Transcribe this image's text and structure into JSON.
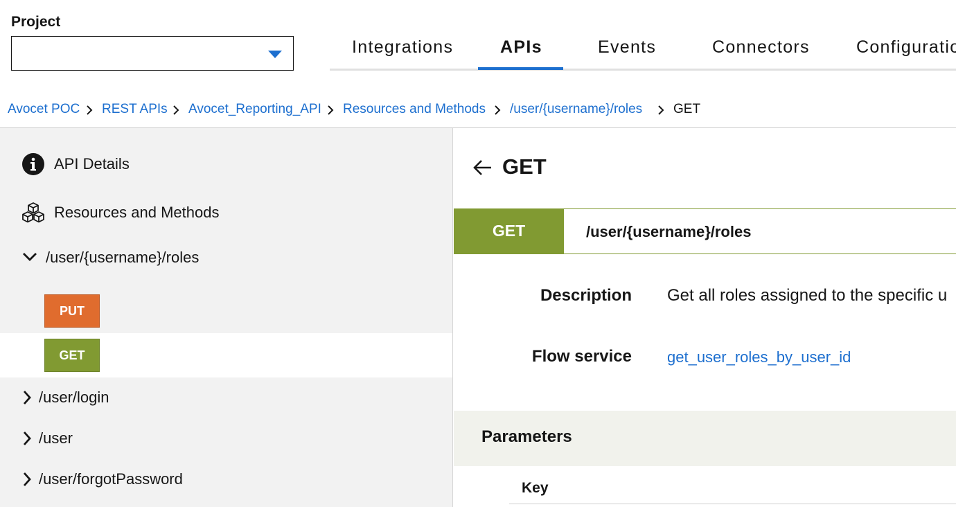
{
  "project": {
    "label": "Project",
    "value": ""
  },
  "tabs": [
    {
      "label": "Integrations",
      "active": false
    },
    {
      "label": "APIs",
      "active": true
    },
    {
      "label": "Events",
      "active": false
    },
    {
      "label": "Connectors",
      "active": false
    },
    {
      "label": "Configuratio",
      "active": false
    }
  ],
  "breadcrumb": [
    {
      "label": "Avocet POC"
    },
    {
      "label": "REST APIs"
    },
    {
      "label": "Avocet_Reporting_API"
    },
    {
      "label": "Resources and Methods"
    },
    {
      "label": "/user/{username}/roles"
    },
    {
      "label": "GET"
    }
  ],
  "sidebar": {
    "api_details": "API Details",
    "resources_methods": "Resources and Methods",
    "expanded_resource": "/user/{username}/roles",
    "methods": [
      {
        "label": "PUT",
        "color": "#e06c2e"
      },
      {
        "label": "GET",
        "color": "#819a32",
        "selected": true
      }
    ],
    "resources": [
      "/user/login",
      "/user",
      "/user/forgotPassword"
    ]
  },
  "main": {
    "title": "GET",
    "method": "GET",
    "path": "/user/{username}/roles",
    "description_label": "Description",
    "description_value": "Get all roles assigned to the specific u",
    "flow_service_label": "Flow service",
    "flow_service_value": "get_user_roles_by_user_id",
    "parameters_title": "Parameters",
    "key_header": "Key"
  },
  "colors": {
    "accent": "#1d6fcf",
    "get": "#819a32",
    "put": "#e06c2e"
  }
}
